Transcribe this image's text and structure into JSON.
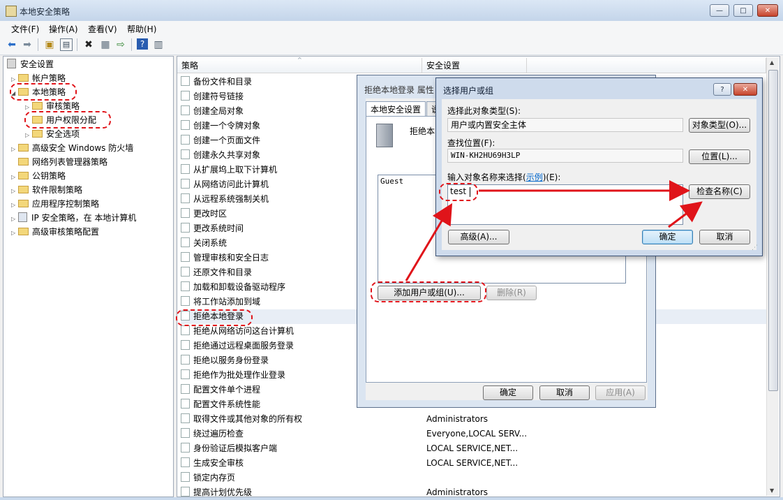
{
  "window": {
    "title": "本地安全策略",
    "min_label": "—",
    "max_label": "□",
    "close_label": "✕"
  },
  "menu": [
    "文件(F)",
    "操作(A)",
    "查看(V)",
    "帮助(H)"
  ],
  "tree": {
    "root": "安全设置",
    "items": [
      "帐户策略",
      "本地策略",
      "审核策略",
      "用户权限分配",
      "安全选项",
      "高级安全 Windows 防火墙",
      "网络列表管理器策略",
      "公钥策略",
      "软件限制策略",
      "应用程序控制策略",
      "IP 安全策略，在 本地计算机",
      "高级审核策略配置"
    ]
  },
  "columns": {
    "policy": "策略",
    "setting": "安全设置"
  },
  "policies": [
    {
      "name": "备份文件和目录",
      "value": ""
    },
    {
      "name": "创建符号链接",
      "value": ""
    },
    {
      "name": "创建全局对象",
      "value": ""
    },
    {
      "name": "创建一个令牌对象",
      "value": ""
    },
    {
      "name": "创建一个页面文件",
      "value": ""
    },
    {
      "name": "创建永久共享对象",
      "value": ""
    },
    {
      "name": "从扩展坞上取下计算机",
      "value": ""
    },
    {
      "name": "从网络访问此计算机",
      "value": ""
    },
    {
      "name": "从远程系统强制关机",
      "value": ""
    },
    {
      "name": "更改时区",
      "value": ""
    },
    {
      "name": "更改系统时间",
      "value": ""
    },
    {
      "name": "关闭系统",
      "value": ""
    },
    {
      "name": "管理审核和安全日志",
      "value": ""
    },
    {
      "name": "还原文件和目录",
      "value": ""
    },
    {
      "name": "加载和卸载设备驱动程序",
      "value": ""
    },
    {
      "name": "将工作站添加到域",
      "value": ""
    },
    {
      "name": "拒绝本地登录",
      "value": ""
    },
    {
      "name": "拒绝从网络访问这台计算机",
      "value": ""
    },
    {
      "name": "拒绝通过远程桌面服务登录",
      "value": ""
    },
    {
      "name": "拒绝以服务身份登录",
      "value": ""
    },
    {
      "name": "拒绝作为批处理作业登录",
      "value": ""
    },
    {
      "name": "配置文件单个进程",
      "value": ""
    },
    {
      "name": "配置文件系统性能",
      "value": ""
    },
    {
      "name": "取得文件或其他对象的所有权",
      "value": "Administrators"
    },
    {
      "name": "绕过遍历检查",
      "value": "Everyone,LOCAL SERV..."
    },
    {
      "name": "身份验证后模拟客户端",
      "value": "LOCAL SERVICE,NET..."
    },
    {
      "name": "生成安全审核",
      "value": "LOCAL SERVICE,NET..."
    },
    {
      "name": "锁定内存页",
      "value": ""
    },
    {
      "name": "提高计划优先级",
      "value": "Administrators"
    }
  ],
  "props_dialog": {
    "title": "拒绝本地登录 属性",
    "tab1": "本地安全设置",
    "tab2": "说",
    "heading": "拒绝本",
    "members": [
      "Guest"
    ],
    "add_button": "添加用户或组(U)...",
    "remove_button": "删除(R)",
    "ok": "确定",
    "cancel": "取消",
    "apply": "应用(A)"
  },
  "select_dialog": {
    "title": "选择用户或组",
    "help_label": "?",
    "close_label": "✕",
    "type_label": "选择此对象类型(S):",
    "type_value": "用户或内置安全主体",
    "type_button": "对象类型(O)...",
    "loc_label": "查找位置(F):",
    "loc_value": "WIN-KH2HU69H3LP",
    "loc_button": "位置(L)...",
    "name_label_prefix": "输入对象名称来选择(",
    "name_label_link": "示例",
    "name_label_suffix": ")(E):",
    "name_value": "test",
    "check_button": "检查名称(C)",
    "advanced_button": "高级(A)...",
    "ok": "确定",
    "cancel": "取消"
  },
  "colors": {
    "annotation": "#e0141a",
    "link": "#0066cc"
  }
}
